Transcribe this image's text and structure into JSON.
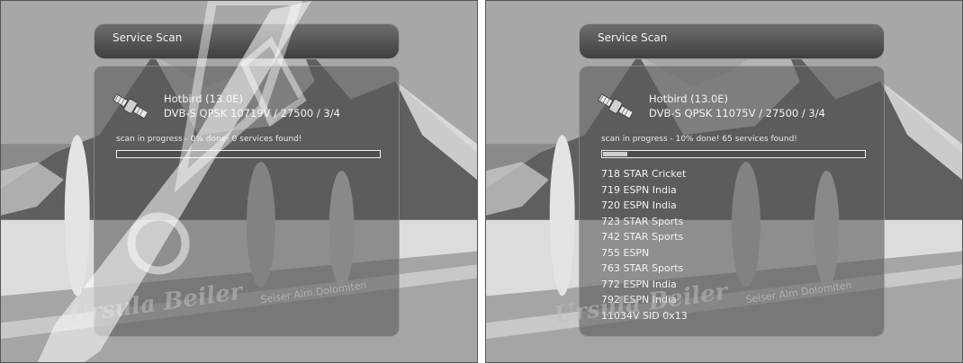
{
  "screens": [
    {
      "title": "Service Scan",
      "satellite": "Hotbird (13.0E)",
      "transponder": "DVB-S QPSK 10719V / 27500 / 3/4",
      "status": "scan in progress - 0% done! 0 services found!",
      "progress": 0,
      "services": []
    },
    {
      "title": "Service Scan",
      "satellite": "Hotbird (13.0E)",
      "transponder": "DVB-S QPSK 11075V / 27500 / 3/4",
      "status": "scan in progress - 10% done! 65 services found!",
      "progress": 10,
      "services": [
        "718 STAR Cricket",
        "719 ESPN India",
        "720 ESPN India",
        "723 STAR Sports",
        "742 STAR Sports",
        "755 ESPN",
        "763 STAR Sports",
        "772 ESPN India",
        "792 ESPN India",
        "11034V SID 0x13"
      ]
    }
  ],
  "background": {
    "photo_credit": "Ursula Beiler",
    "location": "Seiser Alm Dolomiten"
  },
  "icons": {
    "satellite": "satellite-icon"
  }
}
